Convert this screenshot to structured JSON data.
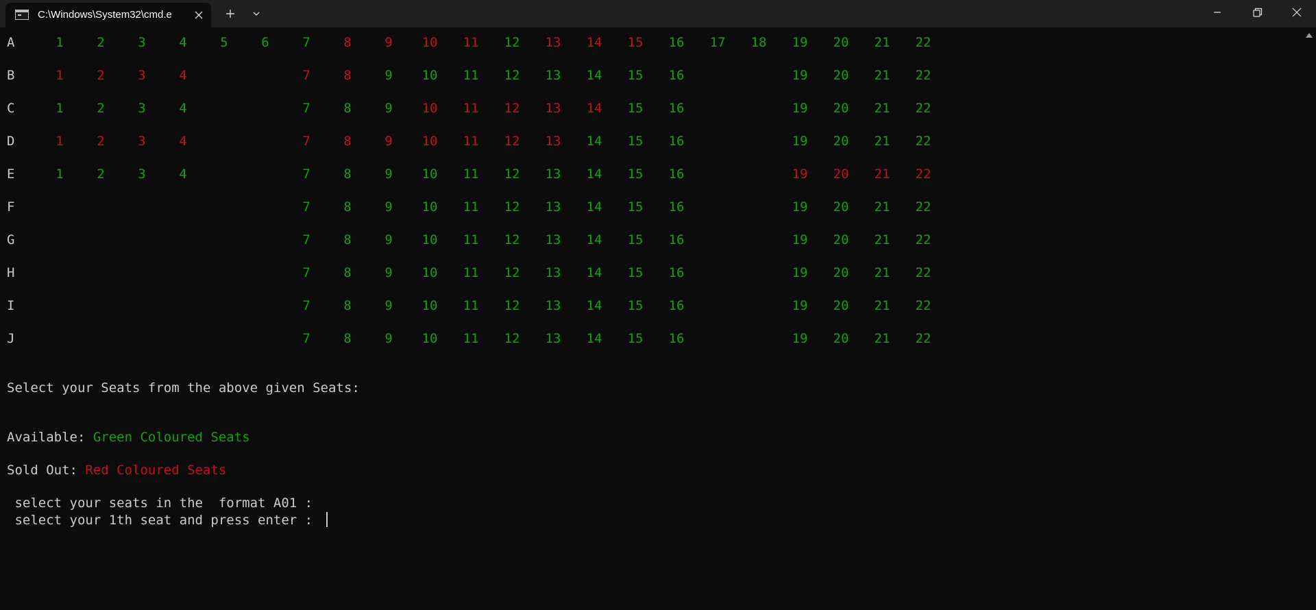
{
  "window": {
    "tab_title": "C:\\Windows\\System32\\cmd.e",
    "icons": {
      "tab": "console-icon",
      "close_tab": "close-icon",
      "new_tab": "plus-icon",
      "dropdown": "chevron-down-icon",
      "minimize": "minimize-icon",
      "maximize": "restore-icon",
      "close": "close-icon"
    }
  },
  "colors": {
    "available": "#13a10e",
    "sold": "#c50f1f",
    "text": "#cccccc",
    "background": "#0c0c0c"
  },
  "seating": {
    "rows": [
      {
        "label": "A",
        "seats": [
          {
            "n": "1",
            "s": "available"
          },
          {
            "n": "2",
            "s": "available"
          },
          {
            "n": "3",
            "s": "available"
          },
          {
            "n": "4",
            "s": "available"
          },
          {
            "n": "5",
            "s": "available"
          },
          {
            "n": "6",
            "s": "available"
          },
          {
            "n": "7",
            "s": "available"
          },
          {
            "n": "8",
            "s": "sold"
          },
          {
            "n": "9",
            "s": "sold"
          },
          {
            "n": "10",
            "s": "sold"
          },
          {
            "n": "11",
            "s": "sold"
          },
          {
            "n": "12",
            "s": "available"
          },
          {
            "n": "13",
            "s": "sold"
          },
          {
            "n": "14",
            "s": "sold"
          },
          {
            "n": "15",
            "s": "sold"
          },
          {
            "n": "16",
            "s": "available"
          },
          {
            "n": "17",
            "s": "available"
          },
          {
            "n": "18",
            "s": "available"
          },
          {
            "n": "19",
            "s": "available"
          },
          {
            "n": "20",
            "s": "available"
          },
          {
            "n": "21",
            "s": "available"
          },
          {
            "n": "22",
            "s": "available"
          }
        ]
      },
      {
        "label": "B",
        "seats": [
          {
            "n": "1",
            "s": "sold"
          },
          {
            "n": "2",
            "s": "sold"
          },
          {
            "n": "3",
            "s": "sold"
          },
          {
            "n": "4",
            "s": "sold"
          },
          {
            "n": "7",
            "s": "sold"
          },
          {
            "n": "8",
            "s": "sold"
          },
          {
            "n": "9",
            "s": "available"
          },
          {
            "n": "10",
            "s": "available"
          },
          {
            "n": "11",
            "s": "available"
          },
          {
            "n": "12",
            "s": "available"
          },
          {
            "n": "13",
            "s": "available"
          },
          {
            "n": "14",
            "s": "available"
          },
          {
            "n": "15",
            "s": "available"
          },
          {
            "n": "16",
            "s": "available"
          },
          {
            "n": "19",
            "s": "available"
          },
          {
            "n": "20",
            "s": "available"
          },
          {
            "n": "21",
            "s": "available"
          },
          {
            "n": "22",
            "s": "available"
          }
        ]
      },
      {
        "label": "C",
        "seats": [
          {
            "n": "1",
            "s": "available"
          },
          {
            "n": "2",
            "s": "available"
          },
          {
            "n": "3",
            "s": "available"
          },
          {
            "n": "4",
            "s": "available"
          },
          {
            "n": "7",
            "s": "available"
          },
          {
            "n": "8",
            "s": "available"
          },
          {
            "n": "9",
            "s": "available"
          },
          {
            "n": "10",
            "s": "sold"
          },
          {
            "n": "11",
            "s": "sold"
          },
          {
            "n": "12",
            "s": "sold"
          },
          {
            "n": "13",
            "s": "sold"
          },
          {
            "n": "14",
            "s": "sold"
          },
          {
            "n": "15",
            "s": "available"
          },
          {
            "n": "16",
            "s": "available"
          },
          {
            "n": "19",
            "s": "available"
          },
          {
            "n": "20",
            "s": "available"
          },
          {
            "n": "21",
            "s": "available"
          },
          {
            "n": "22",
            "s": "available"
          }
        ]
      },
      {
        "label": "D",
        "seats": [
          {
            "n": "1",
            "s": "sold"
          },
          {
            "n": "2",
            "s": "sold"
          },
          {
            "n": "3",
            "s": "sold"
          },
          {
            "n": "4",
            "s": "sold"
          },
          {
            "n": "7",
            "s": "sold"
          },
          {
            "n": "8",
            "s": "sold"
          },
          {
            "n": "9",
            "s": "sold"
          },
          {
            "n": "10",
            "s": "sold"
          },
          {
            "n": "11",
            "s": "sold"
          },
          {
            "n": "12",
            "s": "sold"
          },
          {
            "n": "13",
            "s": "sold"
          },
          {
            "n": "14",
            "s": "available"
          },
          {
            "n": "15",
            "s": "available"
          },
          {
            "n": "16",
            "s": "available"
          },
          {
            "n": "19",
            "s": "available"
          },
          {
            "n": "20",
            "s": "available"
          },
          {
            "n": "21",
            "s": "available"
          },
          {
            "n": "22",
            "s": "available"
          }
        ]
      },
      {
        "label": "E",
        "seats": [
          {
            "n": "1",
            "s": "available"
          },
          {
            "n": "2",
            "s": "available"
          },
          {
            "n": "3",
            "s": "available"
          },
          {
            "n": "4",
            "s": "available"
          },
          {
            "n": "7",
            "s": "available"
          },
          {
            "n": "8",
            "s": "available"
          },
          {
            "n": "9",
            "s": "available"
          },
          {
            "n": "10",
            "s": "available"
          },
          {
            "n": "11",
            "s": "available"
          },
          {
            "n": "12",
            "s": "available"
          },
          {
            "n": "13",
            "s": "available"
          },
          {
            "n": "14",
            "s": "available"
          },
          {
            "n": "15",
            "s": "available"
          },
          {
            "n": "16",
            "s": "available"
          },
          {
            "n": "19",
            "s": "sold"
          },
          {
            "n": "20",
            "s": "sold"
          },
          {
            "n": "21",
            "s": "sold"
          },
          {
            "n": "22",
            "s": "sold"
          }
        ]
      },
      {
        "label": "F",
        "seats": [
          {
            "n": "7",
            "s": "available"
          },
          {
            "n": "8",
            "s": "available"
          },
          {
            "n": "9",
            "s": "available"
          },
          {
            "n": "10",
            "s": "available"
          },
          {
            "n": "11",
            "s": "available"
          },
          {
            "n": "12",
            "s": "available"
          },
          {
            "n": "13",
            "s": "available"
          },
          {
            "n": "14",
            "s": "available"
          },
          {
            "n": "15",
            "s": "available"
          },
          {
            "n": "16",
            "s": "available"
          },
          {
            "n": "19",
            "s": "available"
          },
          {
            "n": "20",
            "s": "available"
          },
          {
            "n": "21",
            "s": "available"
          },
          {
            "n": "22",
            "s": "available"
          }
        ]
      },
      {
        "label": "G",
        "seats": [
          {
            "n": "7",
            "s": "available"
          },
          {
            "n": "8",
            "s": "available"
          },
          {
            "n": "9",
            "s": "available"
          },
          {
            "n": "10",
            "s": "available"
          },
          {
            "n": "11",
            "s": "available"
          },
          {
            "n": "12",
            "s": "available"
          },
          {
            "n": "13",
            "s": "available"
          },
          {
            "n": "14",
            "s": "available"
          },
          {
            "n": "15",
            "s": "available"
          },
          {
            "n": "16",
            "s": "available"
          },
          {
            "n": "19",
            "s": "available"
          },
          {
            "n": "20",
            "s": "available"
          },
          {
            "n": "21",
            "s": "available"
          },
          {
            "n": "22",
            "s": "available"
          }
        ]
      },
      {
        "label": "H",
        "seats": [
          {
            "n": "7",
            "s": "available"
          },
          {
            "n": "8",
            "s": "available"
          },
          {
            "n": "9",
            "s": "available"
          },
          {
            "n": "10",
            "s": "available"
          },
          {
            "n": "11",
            "s": "available"
          },
          {
            "n": "12",
            "s": "available"
          },
          {
            "n": "13",
            "s": "available"
          },
          {
            "n": "14",
            "s": "available"
          },
          {
            "n": "15",
            "s": "available"
          },
          {
            "n": "16",
            "s": "available"
          },
          {
            "n": "19",
            "s": "available"
          },
          {
            "n": "20",
            "s": "available"
          },
          {
            "n": "21",
            "s": "available"
          },
          {
            "n": "22",
            "s": "available"
          }
        ]
      },
      {
        "label": "I",
        "seats": [
          {
            "n": "7",
            "s": "available"
          },
          {
            "n": "8",
            "s": "available"
          },
          {
            "n": "9",
            "s": "available"
          },
          {
            "n": "10",
            "s": "available"
          },
          {
            "n": "11",
            "s": "available"
          },
          {
            "n": "12",
            "s": "available"
          },
          {
            "n": "13",
            "s": "available"
          },
          {
            "n": "14",
            "s": "available"
          },
          {
            "n": "15",
            "s": "available"
          },
          {
            "n": "16",
            "s": "available"
          },
          {
            "n": "19",
            "s": "available"
          },
          {
            "n": "20",
            "s": "available"
          },
          {
            "n": "21",
            "s": "available"
          },
          {
            "n": "22",
            "s": "available"
          }
        ]
      },
      {
        "label": "J",
        "seats": [
          {
            "n": "7",
            "s": "available"
          },
          {
            "n": "8",
            "s": "available"
          },
          {
            "n": "9",
            "s": "available"
          },
          {
            "n": "10",
            "s": "available"
          },
          {
            "n": "11",
            "s": "available"
          },
          {
            "n": "12",
            "s": "available"
          },
          {
            "n": "13",
            "s": "available"
          },
          {
            "n": "14",
            "s": "available"
          },
          {
            "n": "15",
            "s": "available"
          },
          {
            "n": "16",
            "s": "available"
          },
          {
            "n": "19",
            "s": "available"
          },
          {
            "n": "20",
            "s": "available"
          },
          {
            "n": "21",
            "s": "available"
          },
          {
            "n": "22",
            "s": "available"
          }
        ]
      }
    ]
  },
  "messages": {
    "instruction": "Select your Seats from the above given Seats:",
    "available_label": "Available: ",
    "available_value": "Green Coloured Seats",
    "sold_label": "Sold Out: ",
    "sold_value": "Red Coloured Seats",
    "prompt_format": " select your seats in the  format A01 :",
    "prompt_seat": " select your 1th seat and press enter : "
  }
}
